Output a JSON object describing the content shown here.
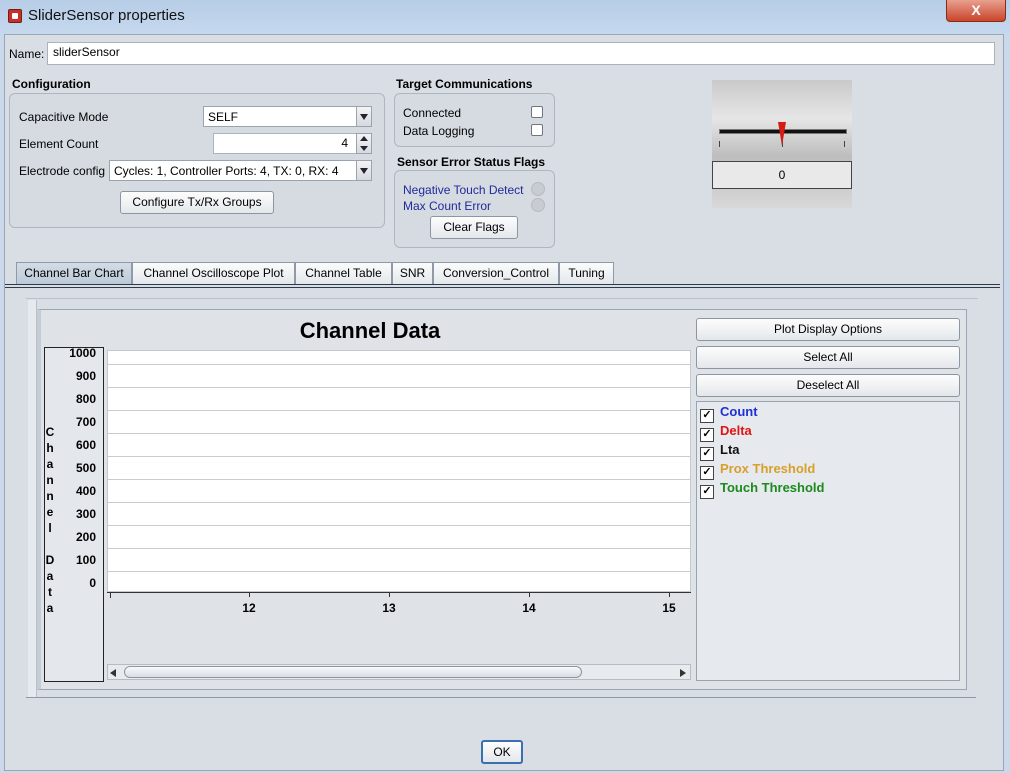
{
  "window": {
    "title": "SliderSensor properties",
    "close_label": "X"
  },
  "name_row": {
    "label": "Name:",
    "value": "sliderSensor"
  },
  "configuration": {
    "title": "Configuration",
    "capacitive_mode_label": "Capacitive Mode",
    "capacitive_mode_value": "SELF",
    "element_count_label": "Element Count",
    "element_count_value": "4",
    "electrode_config_label": "Electrode config",
    "electrode_config_value": "Cycles:  1, Controller Ports:  4, TX:  0, RX:  4",
    "configure_button": "Configure Tx/Rx Groups"
  },
  "target_comm": {
    "title": "Target Communications",
    "connected_label": "Connected",
    "connected_checked": false,
    "data_logging_label": "Data Logging",
    "data_logging_checked": false
  },
  "error_flags": {
    "title": "Sensor Error Status Flags",
    "negative_touch_label": "Negative Touch Detect",
    "max_count_label": "Max Count Error",
    "clear_button": "Clear Flags"
  },
  "slider_preview": {
    "value": "0",
    "position_fraction": 0.5
  },
  "tabs": [
    {
      "label": "Channel Bar Chart",
      "active": true
    },
    {
      "label": "Channel Oscilloscope Plot",
      "active": false
    },
    {
      "label": "Channel Table",
      "active": false
    },
    {
      "label": "SNR",
      "active": false
    },
    {
      "label": "Conversion_Control",
      "active": false
    },
    {
      "label": "Tuning",
      "active": false
    }
  ],
  "chart_panel": {
    "plot_display_options": "Plot Display Options",
    "select_all": "Select All",
    "deselect_all": "Deselect All",
    "legend": [
      {
        "label": "Count",
        "color": "#1f2fd8",
        "checked": true
      },
      {
        "label": "Delta",
        "color": "#e01414",
        "checked": true
      },
      {
        "label": "Lta",
        "color": "#111111",
        "checked": true
      },
      {
        "label": "Prox Threshold",
        "color": "#d8a02a",
        "checked": true
      },
      {
        "label": "Touch Threshold",
        "color": "#1c8a1c",
        "checked": true
      }
    ]
  },
  "chart_data": {
    "type": "bar",
    "title": "Channel Data",
    "ylabel": "Channel Data",
    "xlabel": "",
    "ylim": [
      0,
      1000
    ],
    "y_ticks": [
      "1000",
      "900",
      "800",
      "700",
      "600",
      "500",
      "400",
      "300",
      "200",
      "100",
      "0"
    ],
    "x_ticks": [
      "12",
      "13",
      "14",
      "15"
    ],
    "series": [],
    "grid": true
  },
  "footer": {
    "ok_button": "OK"
  }
}
